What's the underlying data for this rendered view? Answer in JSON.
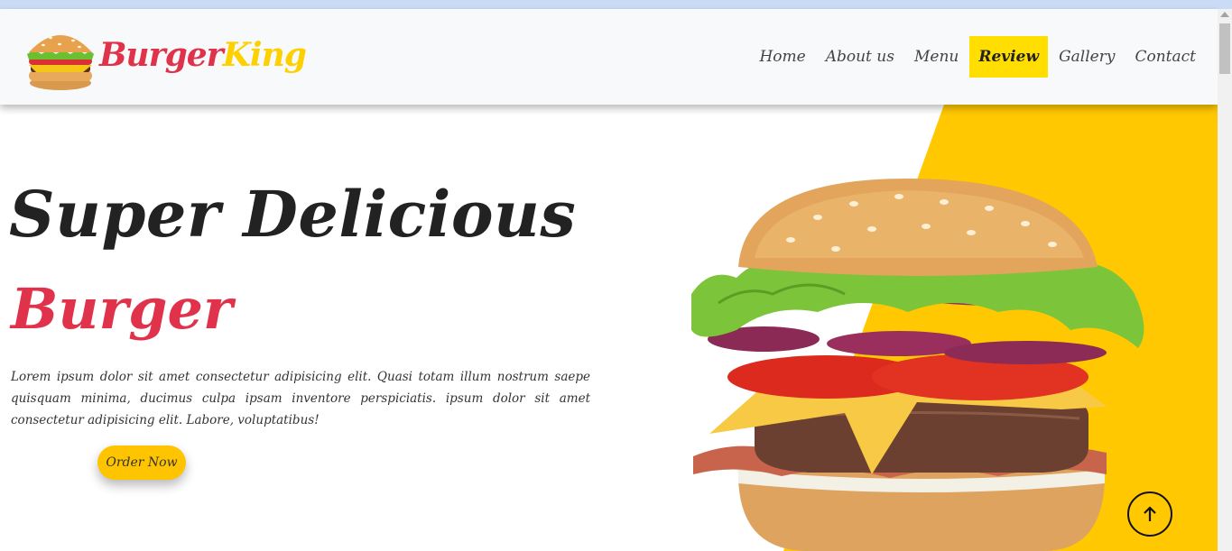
{
  "brand": {
    "name_part1": "Burger",
    "name_part2": "King",
    "logo_icon": "burger-logo-icon"
  },
  "nav": {
    "items": [
      {
        "label": "Home",
        "active": false
      },
      {
        "label": "About us",
        "active": false
      },
      {
        "label": "Menu",
        "active": false
      },
      {
        "label": "Review",
        "active": true
      },
      {
        "label": "Gallery",
        "active": false
      },
      {
        "label": "Contact",
        "active": false
      }
    ]
  },
  "hero": {
    "title": "Super Delicious",
    "subtitle": "Burger",
    "description": "Lorem ipsum dolor sit amet consectetur adipisicing elit. Quasi totam illum nostrum saepe quisquam minima, ducimus culpa ipsam inventore perspiciatis. ipsum dolor sit amet consectetur adipisicing elit. Labore, voluptatibus!",
    "button_label": "Order Now",
    "image": "burger-hero-image"
  },
  "scroll_top": {
    "icon": "arrow-up-icon"
  },
  "colors": {
    "accent_red": "#e0334b",
    "accent_yellow": "#ffc400",
    "nav_active": "#ffde00",
    "text_dark": "#222222"
  }
}
